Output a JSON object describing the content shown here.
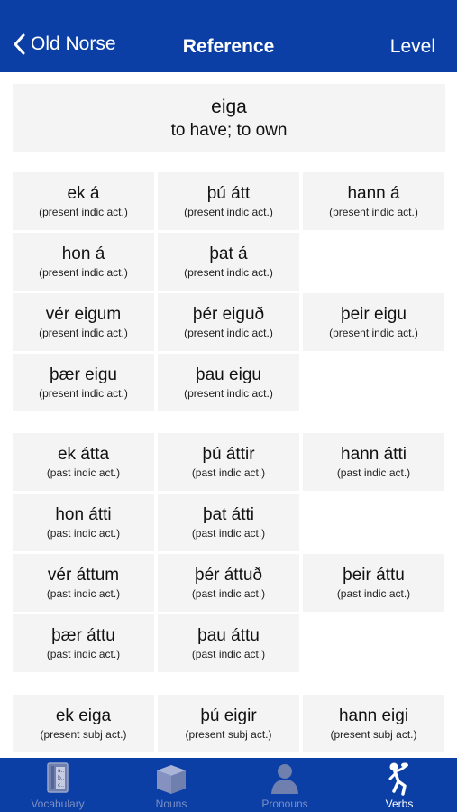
{
  "nav": {
    "back_label": "Old Norse",
    "title": "Reference",
    "right_label": "Level"
  },
  "header": {
    "word": "eiga",
    "meaning": "to have; to own"
  },
  "sections": [
    {
      "cells": [
        {
          "form": "ek á",
          "tag": "(present indic act.)"
        },
        {
          "form": "þú átt",
          "tag": "(present indic act.)"
        },
        {
          "form": "hann á",
          "tag": "(present indic act.)"
        },
        {
          "form": "hon á",
          "tag": "(present indic act.)"
        },
        {
          "form": "þat á",
          "tag": "(present indic act.)"
        },
        null,
        {
          "form": "vér eigum",
          "tag": "(present indic act.)"
        },
        {
          "form": "þér eiguð",
          "tag": "(present indic act.)"
        },
        {
          "form": "þeir eigu",
          "tag": "(present indic act.)"
        },
        {
          "form": "þær eigu",
          "tag": "(present indic act.)"
        },
        {
          "form": "þau eigu",
          "tag": "(present indic act.)"
        },
        null
      ]
    },
    {
      "cells": [
        {
          "form": "ek átta",
          "tag": "(past indic act.)"
        },
        {
          "form": "þú áttir",
          "tag": "(past indic act.)"
        },
        {
          "form": "hann átti",
          "tag": "(past indic act.)"
        },
        {
          "form": "hon átti",
          "tag": "(past indic act.)"
        },
        {
          "form": "þat átti",
          "tag": "(past indic act.)"
        },
        null,
        {
          "form": "vér áttum",
          "tag": "(past indic act.)"
        },
        {
          "form": "þér áttuð",
          "tag": "(past indic act.)"
        },
        {
          "form": "þeir áttu",
          "tag": "(past indic act.)"
        },
        {
          "form": "þær áttu",
          "tag": "(past indic act.)"
        },
        {
          "form": "þau áttu",
          "tag": "(past indic act.)"
        },
        null
      ]
    },
    {
      "cells": [
        {
          "form": "ek eiga",
          "tag": "(present subj act.)"
        },
        {
          "form": "þú eigir",
          "tag": "(present subj act.)"
        },
        {
          "form": "hann eigi",
          "tag": "(present subj act.)"
        }
      ]
    }
  ],
  "tabs": [
    {
      "label": "Vocabulary",
      "icon": "vocabulary-icon",
      "active": false
    },
    {
      "label": "Nouns",
      "icon": "nouns-icon",
      "active": false
    },
    {
      "label": "Pronouns",
      "icon": "pronouns-icon",
      "active": false
    },
    {
      "label": "Verbs",
      "icon": "verbs-icon",
      "active": true
    }
  ],
  "colors": {
    "nav_bg": "#0b3fa6",
    "cell_bg": "#f4f4f4",
    "tab_inactive": "#7d8fc2",
    "tab_active": "#ffffff"
  }
}
